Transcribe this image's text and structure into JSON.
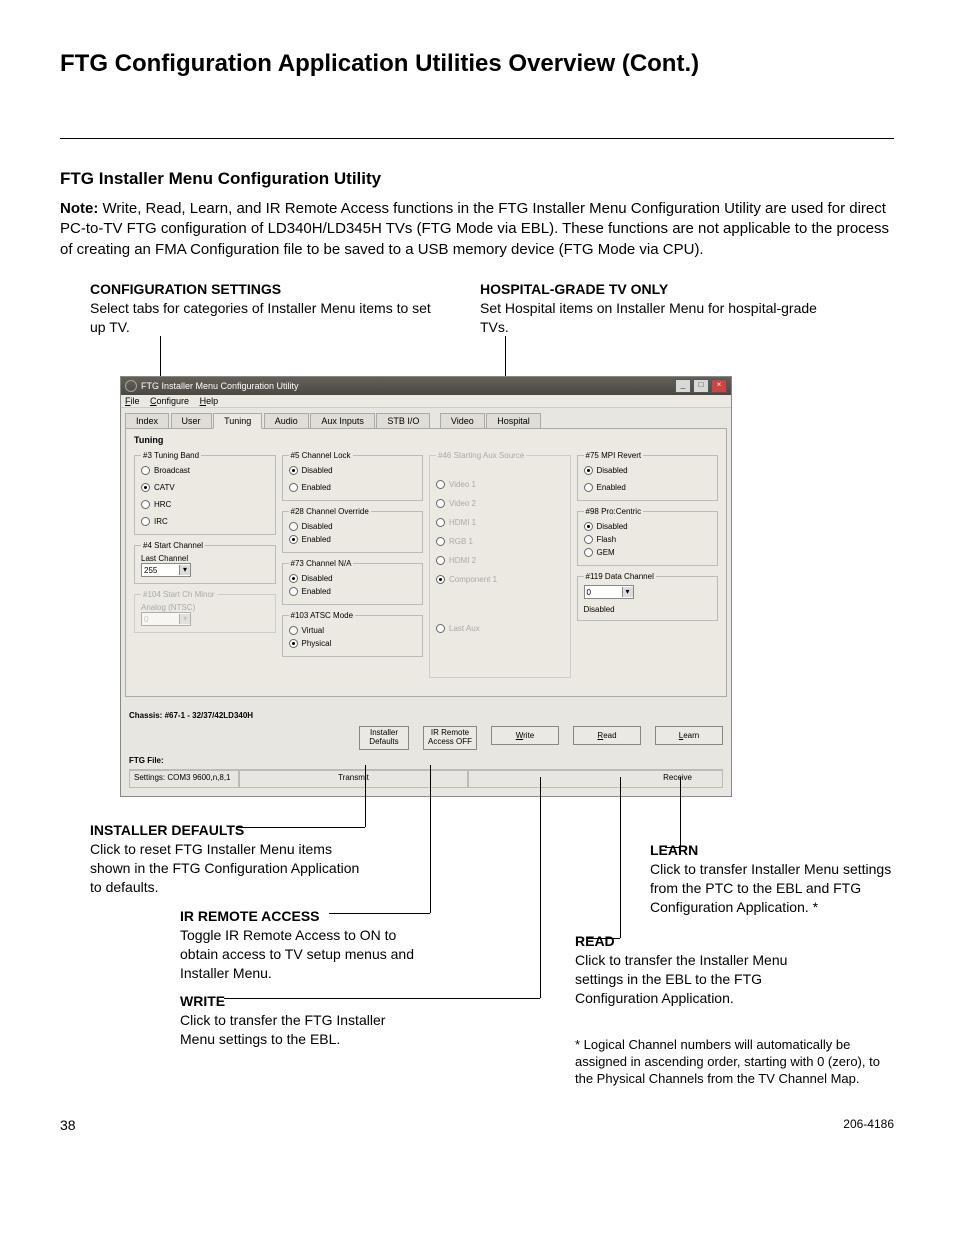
{
  "page": {
    "title": "FTG Configuration Application Utilities Overview (Cont.)",
    "section_heading": "FTG Installer Menu Configuration Utility",
    "note_label": "Note:",
    "note_body": " Write, Read, Learn, and IR Remote Access functions in the FTG Installer Menu Configuration Utility are used for direct PC-to-TV FTG configuration of LD340H/LD345H TVs (FTG Mode via EBL). These functions are not applicable to the process of creating an FMA Configuration file to be saved to a USB memory device (FTG Mode via CPU).",
    "page_number": "38",
    "doc_number": "206-4186"
  },
  "callouts": {
    "config_title": "CONFIGURATION SETTINGS",
    "config_body": "Select tabs for categories of Installer Menu items to set up TV.",
    "hospital_title": "HOSPITAL-GRADE TV ONLY",
    "hospital_body": "Set Hospital items on Installer Menu for hospital-grade TVs.",
    "defaults_title": "INSTALLER DEFAULTS",
    "defaults_body": "Click to reset FTG Installer Menu items shown in the FTG Configuration Application to defaults.",
    "ir_title": "IR REMOTE ACCESS",
    "ir_body": "Toggle IR Remote Access to ON to obtain access to TV setup menus and Installer Menu.",
    "write_title": "WRITE",
    "write_body": "Click to transfer the FTG Installer Menu settings to the EBL.",
    "read_title": "READ",
    "read_body": "Click to transfer the Installer Menu settings in the EBL to the FTG Configuration Application.",
    "learn_title": "LEARN",
    "learn_body": "Click to transfer Installer Menu settings from the PTC to the EBL and FTG Configuration Application. *",
    "footnote_mark": "*",
    "footnote_body": " Logical Channel numbers will automatically be assigned in ascending order, starting with 0 (zero), to the Physical Channels from the TV Channel Map."
  },
  "win": {
    "title": "FTG Installer Menu Configuration Utility",
    "menu": {
      "file": "File",
      "configure": "Configure",
      "help": "Help"
    },
    "tabs": [
      "Index",
      "User",
      "Tuning",
      "Audio",
      "Aux Inputs",
      "STB I/O",
      "Video",
      "Hospital"
    ],
    "active_tab": "Tuning",
    "panel_label": "Tuning",
    "group3": {
      "legend": "#3 Tuning Band",
      "o1": "Broadcast",
      "o2": "CATV",
      "o3": "HRC",
      "o4": "IRC"
    },
    "group4": {
      "legend": "#4 Start Channel",
      "label": "Last Channel",
      "value": "255"
    },
    "group104": {
      "legend": "#104 Start Ch Minor",
      "label": "Analog (NTSC)",
      "value": "0"
    },
    "group5": {
      "legend": "#5 Channel Lock",
      "o1": "Disabled",
      "o2": "Enabled"
    },
    "group28": {
      "legend": "#28 Channel Override",
      "o1": "Disabled",
      "o2": "Enabled"
    },
    "group73": {
      "legend": "#73 Channel N/A",
      "o1": "Disabled",
      "o2": "Enabled"
    },
    "group103": {
      "legend": "#103 ATSC Mode",
      "o1": "Virtual",
      "o2": "Physical"
    },
    "group46": {
      "legend": "#46 Starting Aux Source",
      "o1": "Video 1",
      "o2": "Video 2",
      "o3": "HDMI 1",
      "o4": "RGB 1",
      "o5": "HDMI 2",
      "o6": "Component 1",
      "o7": "Last Aux"
    },
    "group75": {
      "legend": "#75 MPI Revert",
      "o1": "Disabled",
      "o2": "Enabled"
    },
    "group98": {
      "legend": "#98 Pro:Centric",
      "o1": "Disabled",
      "o2": "Flash",
      "o3": "GEM"
    },
    "group119": {
      "legend": "#119 Data Channel",
      "value": "0",
      "label": "Disabled"
    },
    "chassis": "Chassis:  #67-1 - 32/37/42LD340H",
    "ftg_file": "FTG File:",
    "settings": "Settings: COM3 9600,n,8,1",
    "transmit": "Transmit",
    "receive": "Receive",
    "btn_defaults": "Installer\nDefaults",
    "btn_ir": "IR Remote\nAccess OFF",
    "btn_write": "Write",
    "btn_read": "Read",
    "btn_learn": "Learn"
  }
}
